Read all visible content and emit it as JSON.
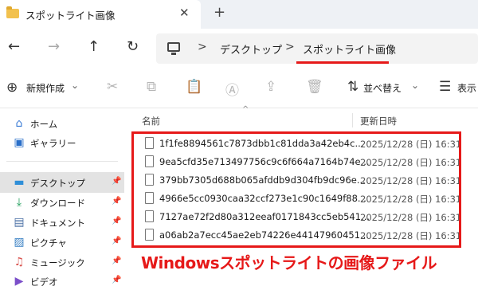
{
  "tab": {
    "title": "スポットライト画像",
    "close": "✕",
    "add": "+"
  },
  "nav": {
    "back": "←",
    "forward": "→",
    "up": "↑",
    "refresh": "↻"
  },
  "address": {
    "separator": ">",
    "crumbs": [
      "デスクトップ",
      "スポットライト画像"
    ]
  },
  "toolbar": {
    "new_label": "新規作成",
    "new_plus": "⊕",
    "new_chevron": "⌄",
    "cut": "✂",
    "copy": "⧉",
    "paste": "📋",
    "rename": "Ⓐ",
    "share": "⇪",
    "delete": "🗑",
    "sort_label": "並べ替え",
    "sort_icon": "⇅",
    "sort_chevron": "⌄",
    "view_label": "表示",
    "view_icon": "☰"
  },
  "sidebar": {
    "items": [
      {
        "label": "ホーム",
        "icon": "home-icon",
        "glyph": "⌂",
        "color": "#3a7bd5"
      },
      {
        "label": "ギャラリー",
        "icon": "gallery-icon",
        "glyph": "▣",
        "color": "#2a6fc9"
      },
      {
        "label": "デスクトップ",
        "icon": "desktop-icon",
        "glyph": "▬",
        "color": "#2f8fd8"
      },
      {
        "label": "ダウンロード",
        "icon": "download-icon",
        "glyph": "⤓",
        "color": "#1e9e5a"
      },
      {
        "label": "ドキュメント",
        "icon": "document-icon",
        "glyph": "▤",
        "color": "#4a6fa5"
      },
      {
        "label": "ピクチャ",
        "icon": "pictures-icon",
        "glyph": "▨",
        "color": "#3b82c4"
      },
      {
        "label": "ミュージック",
        "icon": "music-icon",
        "glyph": "♫",
        "color": "#d9534f"
      },
      {
        "label": "ビデオ",
        "icon": "video-icon",
        "glyph": "▶",
        "color": "#7b4fc9"
      }
    ],
    "pin": "📌"
  },
  "columns": {
    "name": "名前",
    "date": "更新日時",
    "sort_indicator": "^"
  },
  "files": [
    {
      "name": "1f1fe8894561c7873dbb1c81dda3a42eb4c...",
      "date": "2025/12/28 (日) 16:31"
    },
    {
      "name": "9ea5cfd35e713497756c9c6f664a7164b74e...",
      "date": "2025/12/28 (日) 16:31"
    },
    {
      "name": "379bb7305d688b065afddb9d304fb9dc96e...",
      "date": "2025/12/28 (日) 16:31"
    },
    {
      "name": "4966e5cc0930caa32ccf273e1c90c1649f88...",
      "date": "2025/12/28 (日) 16:31"
    },
    {
      "name": "7127ae72f2d80a312eeaf0171843cc5eb541...",
      "date": "2025/12/28 (日) 16:31"
    },
    {
      "name": "a06ab2a7ecc45ae2eb74226e44147960451...",
      "date": "2025/12/28 (日) 16:31"
    }
  ],
  "caption": "Windowsスポットライトの画像ファイル",
  "colors": {
    "accent_red": "#e61919",
    "selected_bg": "#e3e3e3"
  }
}
